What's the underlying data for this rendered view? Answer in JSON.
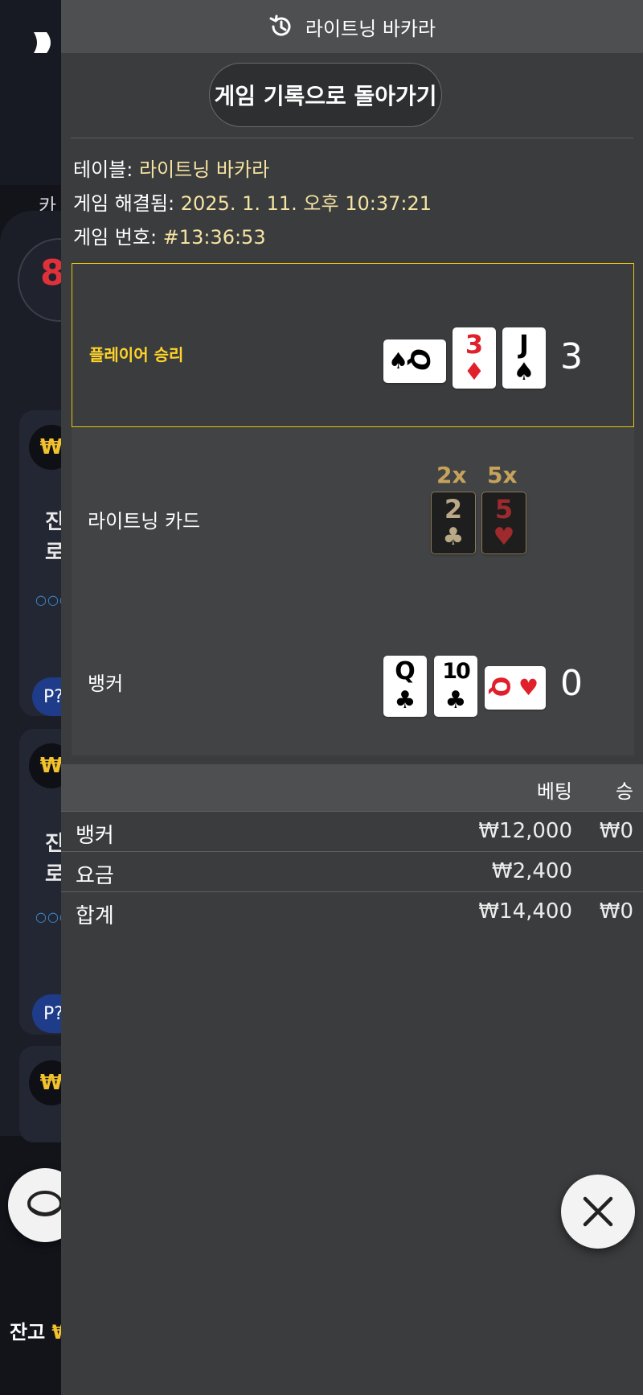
{
  "panel": {
    "title": "라이트닝 바카라",
    "back_button": "게임 기록으로 돌아가기",
    "info": {
      "table_label": "테이블:",
      "table_value": "라이트닝 바카라",
      "resolved_label": "게임 해결됨:",
      "resolved_value": "2025. 1. 11. 오후 10:37:21",
      "game_no_label": "게임 번호:",
      "game_no_value": "#13:36:53"
    },
    "player": {
      "label": "플레이어 승리",
      "score": "3",
      "cards": [
        {
          "rank": "Q",
          "suit": "♠",
          "color": "black",
          "orientation": "sideways"
        },
        {
          "rank": "3",
          "suit": "♦",
          "color": "red"
        },
        {
          "rank": "J",
          "suit": "♠",
          "color": "black"
        }
      ]
    },
    "lightning": {
      "label": "라이트닝 카드",
      "cards": [
        {
          "multiplier": "2x",
          "rank": "2",
          "suit": "♣"
        },
        {
          "multiplier": "5x",
          "rank": "5",
          "suit": "♥"
        }
      ]
    },
    "banker": {
      "label": "뱅커",
      "score": "0",
      "cards": [
        {
          "rank": "Q",
          "suit": "♣",
          "color": "black"
        },
        {
          "rank": "10",
          "suit": "♣",
          "color": "black"
        },
        {
          "rank": "Q",
          "suit": "♥",
          "color": "red",
          "orientation": "sideways"
        }
      ]
    },
    "bets": {
      "col_bet": "베팅",
      "col_win": "승",
      "rows": [
        {
          "name": "뱅커",
          "bet": "₩12,000",
          "win": "₩0"
        },
        {
          "name": "요금",
          "bet": "₩2,400",
          "win": ""
        },
        {
          "name": "합계",
          "bet": "₩14,400",
          "win": "₩0"
        }
      ]
    }
  },
  "background": {
    "category_partial": "카",
    "tile_1_chip": "₩",
    "tile_1_text": "진\n로",
    "tile_2_chip": "₩",
    "tile_2_text": "진\n로",
    "tile_3_chip": "₩",
    "p_button": "P?",
    "balance_label": "잔고",
    "balance_value": "₩"
  },
  "icons": {
    "title": "history-icon",
    "close": "close-icon"
  },
  "colors": {
    "accent_gold": "#e5c40f",
    "player_win": "#ffd42a",
    "red_suit": "#e0212b",
    "multiplier": "#c6a25a"
  }
}
